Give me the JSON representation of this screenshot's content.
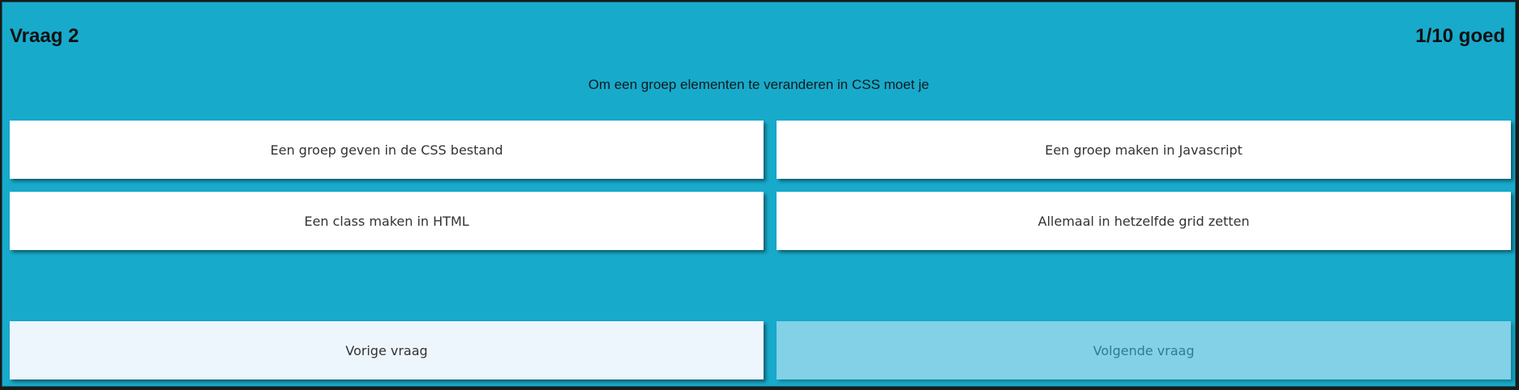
{
  "header": {
    "title": "Vraag 2",
    "score": "1/10 goed"
  },
  "question": {
    "text": "Om een groep elementen te veranderen in CSS moet je"
  },
  "answers": [
    {
      "label": "Een groep geven in de CSS bestand"
    },
    {
      "label": "Een groep maken in Javascript"
    },
    {
      "label": "Een class maken in HTML"
    },
    {
      "label": "Allemaal in hetzelfde grid zetten"
    }
  ],
  "navigation": {
    "previous_label": "Vorige vraag",
    "next_label": "Volgende vraag"
  },
  "colors": {
    "background": "#18aacb",
    "answer_bg": "#ffffff",
    "previous_bg": "#eef6fd",
    "next_bg_disabled": "#82d1e6"
  }
}
